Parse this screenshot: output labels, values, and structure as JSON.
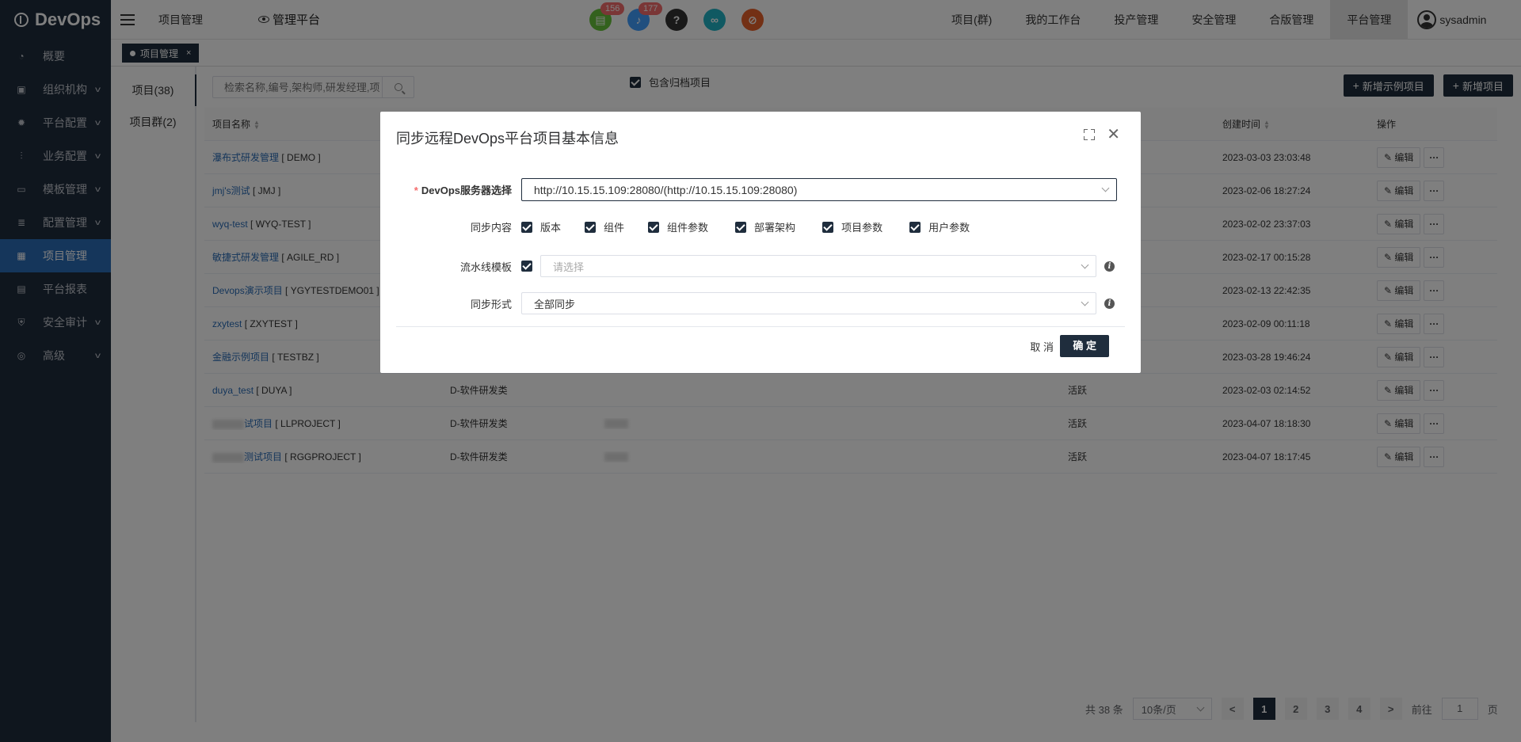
{
  "brand": "DevOps",
  "sidebar": {
    "items": [
      {
        "label": "概要",
        "icon": "dashboard-icon",
        "expandable": false
      },
      {
        "label": "组织机构",
        "icon": "lock-icon",
        "expandable": true
      },
      {
        "label": "平台配置",
        "icon": "gear-icon",
        "expandable": true
      },
      {
        "label": "业务配置",
        "icon": "sliders-icon",
        "expandable": true
      },
      {
        "label": "模板管理",
        "icon": "template-icon",
        "expandable": true
      },
      {
        "label": "配置管理",
        "icon": "database-icon",
        "expandable": true
      },
      {
        "label": "项目管理",
        "icon": "grid-icon",
        "expandable": false,
        "active": true
      },
      {
        "label": "平台报表",
        "icon": "report-icon",
        "expandable": false
      },
      {
        "label": "安全审计",
        "icon": "shield-icon",
        "expandable": true
      },
      {
        "label": "高级",
        "icon": "advanced-icon",
        "expandable": true
      }
    ]
  },
  "topbar": {
    "breadcrumb": "项目管理",
    "platform": "管理平台",
    "badges": {
      "doc": "156",
      "bell": "177"
    },
    "nav": [
      "项目(群)",
      "我的工作台",
      "投产管理",
      "安全管理",
      "合版管理",
      "平台管理"
    ],
    "active_nav": "平台管理",
    "user": "sysadmin"
  },
  "tag": {
    "label": "项目管理",
    "close": "×"
  },
  "tabs": {
    "projects": "项目(38)",
    "groups": "项目群(2)"
  },
  "search": {
    "placeholder": "检索名称,编号,架构师,研发经理,项"
  },
  "archive_label": "包含归档项目",
  "buttons": {
    "new_example": "新增示例项目",
    "new_project": "新增项目"
  },
  "table": {
    "headers": {
      "name": "项目名称",
      "created": "创建时间",
      "ops": "操作"
    },
    "edit_label": "编辑",
    "more_label": "···",
    "rows": [
      {
        "name": "瀑布式研发管理",
        "code": "[ DEMO ]",
        "dept": "",
        "status": "",
        "created": "2023-03-03 23:03:48"
      },
      {
        "name": "jmj's测试",
        "code": "[ JMJ ]",
        "dept": "",
        "status": "",
        "created": "2023-02-06 18:27:24"
      },
      {
        "name": "wyq-test",
        "code": "[ WYQ-TEST ]",
        "dept": "",
        "status": "",
        "created": "2023-02-02 23:37:03"
      },
      {
        "name": "敏捷式研发管理",
        "code": "[ AGILE_RD ]",
        "dept": "",
        "status": "",
        "created": "2023-02-17 00:15:28"
      },
      {
        "name": "Devops演示项目",
        "code": "[ YGYTESTDEMO01 ]",
        "dept": "",
        "status": "",
        "created": "2023-02-13 22:42:35"
      },
      {
        "name": "zxytest",
        "code": "[ ZXYTEST ]",
        "dept": "",
        "status": "",
        "created": "2023-02-09 00:11:18"
      },
      {
        "name": "金融示例项目",
        "code": "[ TESTBZ ]",
        "dept": "",
        "status": "",
        "created": "2023-03-28 19:46:24"
      },
      {
        "name": "duya_test",
        "code": "[ DUYA ]",
        "dept": "D-软件研发类",
        "status": "活跃",
        "created": "2023-02-03 02:14:52"
      },
      {
        "name": "试项目",
        "code": "[ LLPROJECT ]",
        "dept": "D-软件研发类",
        "status": "活跃",
        "created": "2023-04-07 18:18:30"
      },
      {
        "name": "测试项目",
        "code": "[ RGGPROJECT ]",
        "dept": "D-软件研发类",
        "status": "活跃",
        "created": "2023-04-07 18:17:45"
      }
    ]
  },
  "pager": {
    "total": "共 38 条",
    "page_size": "10条/页",
    "prev": "<",
    "pages": [
      "1",
      "2",
      "3",
      "4"
    ],
    "next": ">",
    "goto": "前往",
    "goto_value": "1",
    "page_unit": "页"
  },
  "dialog": {
    "title": "同步远程DevOps平台项目基本信息",
    "server_label": "DevOps服务器选择",
    "server_value": "http://10.15.15.109:28080/(http://10.15.15.109:28080)",
    "sync_content_label": "同步内容",
    "sync_items": [
      "版本",
      "组件",
      "组件参数",
      "部署架构",
      "项目参数",
      "用户参数"
    ],
    "pipeline_label": "流水线模板",
    "pipeline_placeholder": "请选择",
    "sync_mode_label": "同步形式",
    "sync_mode_value": "全部同步",
    "cancel": "取 消",
    "ok": "确 定"
  }
}
